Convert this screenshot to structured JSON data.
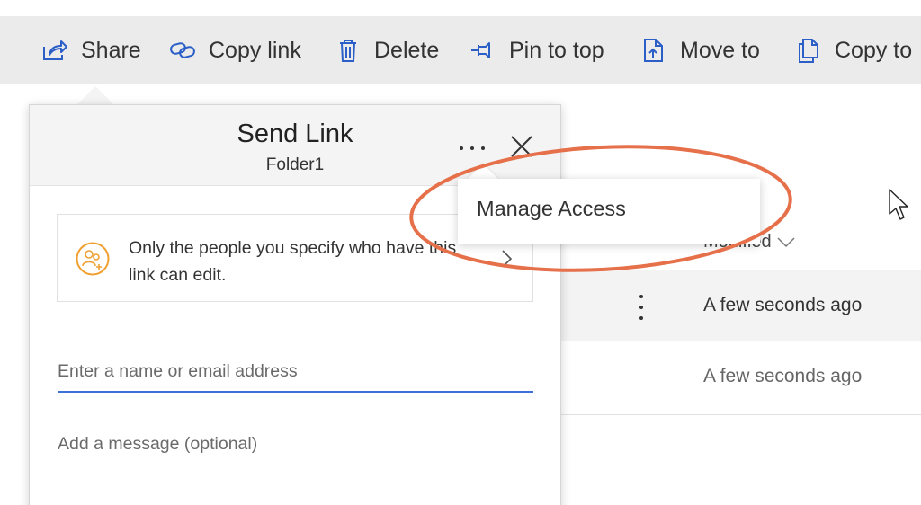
{
  "toolbar": {
    "items": [
      {
        "label": "Share",
        "icon": "share-icon"
      },
      {
        "label": "Copy link",
        "icon": "link-icon"
      },
      {
        "label": "Delete",
        "icon": "trash-icon"
      },
      {
        "label": "Pin to top",
        "icon": "pin-icon"
      },
      {
        "label": "Move to",
        "icon": "move-to-icon"
      },
      {
        "label": "Copy to",
        "icon": "copy-to-icon"
      }
    ]
  },
  "file_list": {
    "column_header": "Modified",
    "rows": [
      {
        "modified": "A few seconds ago"
      },
      {
        "modified": "A few seconds ago"
      }
    ]
  },
  "send_link": {
    "title": "Send Link",
    "subtitle": "Folder1",
    "link_settings_text": "Only the people you specify who have this link can edit.",
    "email_placeholder": "Enter a name or email address",
    "message_placeholder": "Add a message (optional)"
  },
  "more_menu": {
    "items": [
      {
        "label": "Manage Access"
      }
    ]
  },
  "colors": {
    "accent_blue": "#2b5fc7",
    "orange_icon": "#f0a030",
    "highlight": "#e5704a",
    "toolbar_bg": "#ebebeb"
  }
}
